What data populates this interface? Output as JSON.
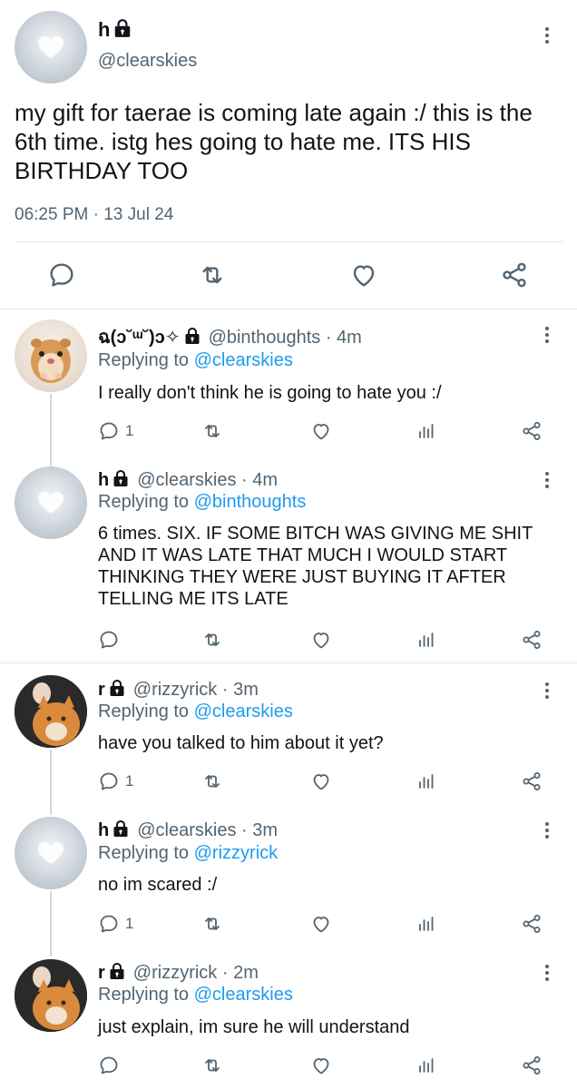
{
  "main_tweet": {
    "name": "h",
    "handle": "@clearskies",
    "text": "my gift for taerae is coming late again :/ this is the 6th time. istg hes going to hate me. ITS HIS BIRTHDAY TOO",
    "time": "06:25 PM · 13 Jul 24"
  },
  "replies": [
    {
      "name": "ฉ(ɔ˘ᵚ˘)ɔ✧",
      "handle": "@binthoughts · 4m",
      "replying_prefix": "Replying to ",
      "replying_to": "@clearskies",
      "text": "I really don't think he is going to hate you :/",
      "comment_count": "1"
    },
    {
      "name": "h",
      "handle": "@clearskies · 4m",
      "replying_prefix": "Replying to ",
      "replying_to": "@binthoughts",
      "text": "6 times. SIX. IF SOME BITCH WAS GIVING ME SHIT AND IT WAS LATE THAT MUCH I WOULD START THINKING THEY WERE JUST BUYING IT AFTER TELLING ME ITS LATE",
      "comment_count": ""
    },
    {
      "name": "r",
      "handle": "@rizzyrick · 3m",
      "replying_prefix": "Replying to ",
      "replying_to": "@clearskies",
      "text": "have you talked to him about it yet?",
      "comment_count": "1"
    },
    {
      "name": "h",
      "handle": "@clearskies · 3m",
      "replying_prefix": "Replying to ",
      "replying_to": "@rizzyrick",
      "text": "no im scared :/",
      "comment_count": "1"
    },
    {
      "name": "r",
      "handle": "@rizzyrick · 2m",
      "replying_prefix": "Replying to ",
      "replying_to": "@clearskies",
      "text": "just explain, im sure he will understand",
      "comment_count": ""
    }
  ],
  "icons": {
    "comment": "comment-icon",
    "retweet": "retweet-icon",
    "like": "heart-icon",
    "views": "views-icon",
    "share": "share-icon",
    "more": "more-icon",
    "lock": "lock-icon"
  },
  "colors": {
    "link": "#1d9bf0",
    "secondary": "#536471",
    "divider": "#e1e6ea"
  }
}
